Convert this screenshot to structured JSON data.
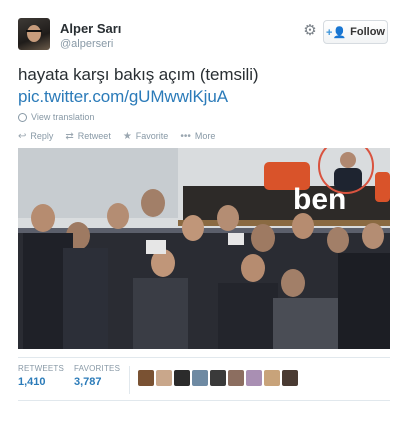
{
  "user": {
    "name": "Alper Sarı",
    "handle": "@alperseri"
  },
  "follow_button": {
    "label": "Follow"
  },
  "tweet": {
    "text": "hayata karşı bakış açım (temsili)",
    "link": "pic.twitter.com/gUMwwlKjuA",
    "translate_label": "View translation"
  },
  "actions": [
    {
      "label": "Reply",
      "icon": "reply-icon"
    },
    {
      "label": "Retweet",
      "icon": "retweet-icon"
    },
    {
      "label": "Favorite",
      "icon": "star-icon"
    },
    {
      "label": "More",
      "icon": "ellipsis-icon"
    }
  ],
  "photo": {
    "overlay_text": "ben"
  },
  "stats": {
    "retweets_label": "RETWEETS",
    "retweets_value": "1,410",
    "favorites_label": "FAVORITES",
    "favorites_value": "3,787"
  },
  "favorited_by_count": 9,
  "colors": {
    "link": "#2b7bb9",
    "follow_icon": "#3b94d9",
    "highlight_circle": "#d9533f",
    "muted": "#8899a6"
  }
}
